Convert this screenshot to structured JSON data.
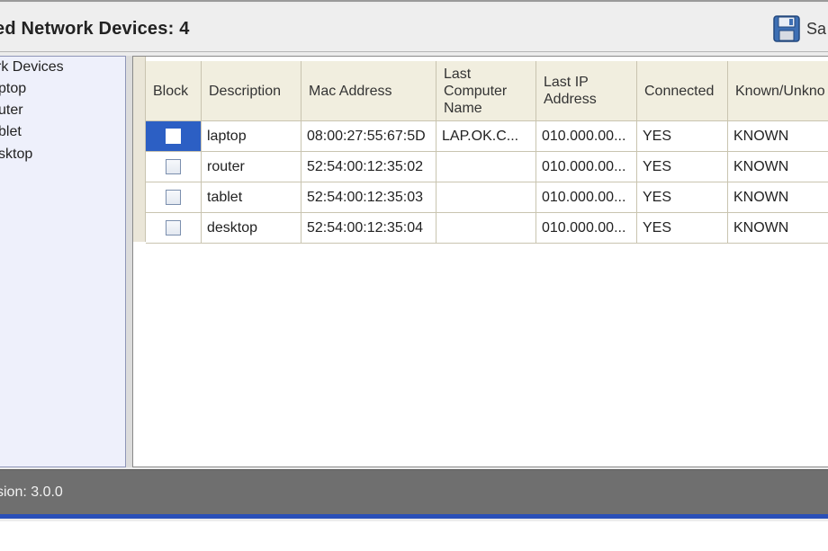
{
  "header": {
    "title": "ed Network Devices: 4",
    "save_label": "Sa"
  },
  "tree": {
    "items": [
      "rk Devices",
      "ptop",
      "uter",
      "blet",
      "sktop"
    ]
  },
  "table": {
    "columns": [
      "Block",
      "Description",
      "Mac Address",
      "Last\nComputer\nName",
      "Last IP\nAddress",
      "Connected",
      "Known/Unkno"
    ],
    "rows": [
      {
        "description": "laptop",
        "mac": "08:00:27:55:67:5D",
        "computer": "LAP.OK.C...",
        "ip": "010.000.00...",
        "connected": "YES",
        "known": "KNOWN",
        "selected": true
      },
      {
        "description": "router",
        "mac": "52:54:00:12:35:02",
        "computer": "",
        "ip": "010.000.00...",
        "connected": "YES",
        "known": "KNOWN",
        "selected": false
      },
      {
        "description": "tablet",
        "mac": "52:54:00:12:35:03",
        "computer": "",
        "ip": "010.000.00...",
        "connected": "YES",
        "known": "KNOWN",
        "selected": false
      },
      {
        "description": "desktop",
        "mac": "52:54:00:12:35:04",
        "computer": "",
        "ip": "010.000.00...",
        "connected": "YES",
        "known": "KNOWN",
        "selected": false
      }
    ]
  },
  "status": {
    "version_text": "sion: 3.0.0"
  },
  "colors": {
    "selection": "#2c5fc4",
    "statusbar": "#6f6f6f",
    "accent_line": "#2a4fb8"
  }
}
